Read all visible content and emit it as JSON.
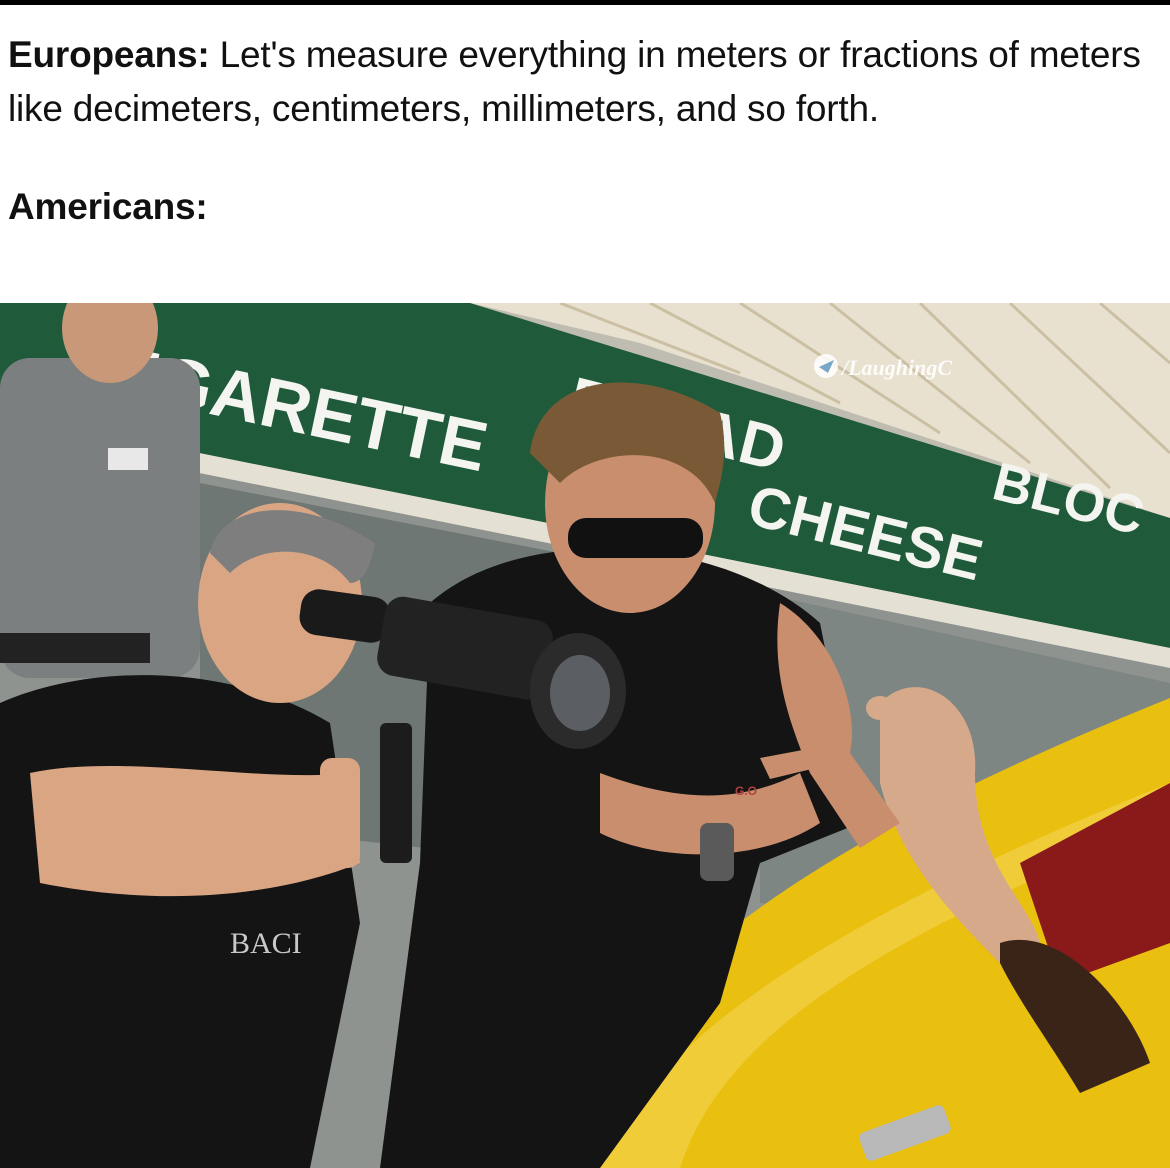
{
  "caption": {
    "line1_speaker": "Europeans:",
    "line1_text": " Let's measure everything in meters or fractions of meters like decimeters, centimeters, millimeters, and so forth.",
    "line2_speaker": "Americans:"
  },
  "photo": {
    "sign": {
      "word1": "IGARETTE",
      "word2": "BREAD",
      "word3": "CHEESE",
      "word4": "BLOC"
    },
    "watermark": "/LaughingC",
    "shirt_text": "BACI",
    "window_tag": "G.O",
    "colors": {
      "sign_green": "#1f5a3a",
      "awning": "#e9e1cf",
      "car_yellow": "#e9bf10",
      "shirt_black": "#141414",
      "skin": "#d9a583"
    }
  }
}
